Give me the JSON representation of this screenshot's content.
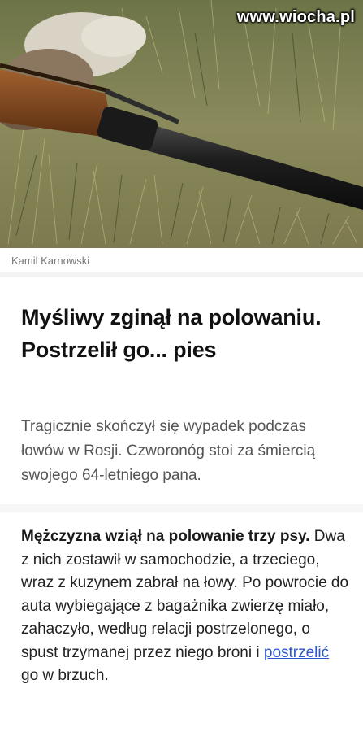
{
  "watermark": "www.wiocha.pl",
  "hero_image": {
    "subject": "rifle lying in grass next to a hunted animal"
  },
  "author": "Kamil Karnowski",
  "article": {
    "title": "Myśliwy zginął na polowaniu. Postrzelił go... pies",
    "lead": "Tragicznie skończył się wypadek podczas łowów w Rosji. Czworonóg stoi za śmiercią swojego 64-letniego pana.",
    "body_strong": "Mężczyzna wziął na polowanie trzy psy.",
    "body_part1": " Dwa z nich zostawił w samochodzie, a trzeciego, wraz z kuzynem zabrał na łowy. Po powrocie do auta wybiegające z bagażnika zwierzę miało, zahaczyło, według relacji postrzelonego, o spust trzymanej przez niego broni i ",
    "body_link": "postrzelić",
    "body_part2": " go w brzuch."
  },
  "colors": {
    "link": "#2b57c9",
    "title": "#111111",
    "lead": "#555555"
  }
}
